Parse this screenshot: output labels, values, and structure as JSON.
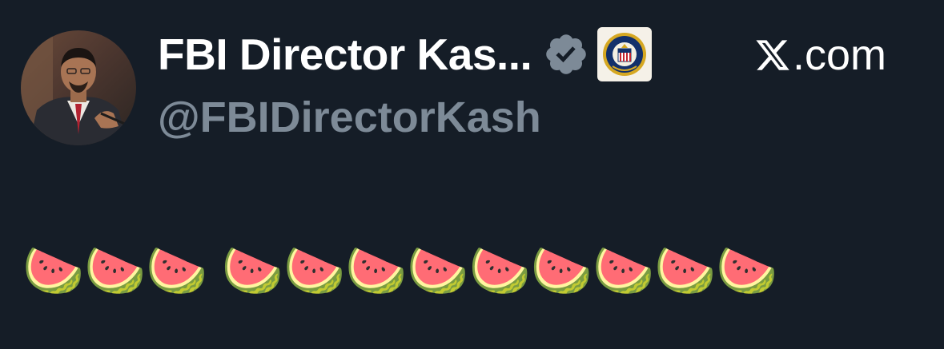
{
  "user": {
    "display_name": "FBI Director Kas...",
    "handle": "@FBIDirectorKash",
    "avatar_icon": "profile-photo",
    "verified_icon": "verified-badge-icon",
    "affiliate_icon": "fbi-seal-icon"
  },
  "brand": {
    "logo_icon": "x-logo-icon",
    "domain": ".com"
  },
  "tweet": {
    "text": "🍉🍉🍉 🍉🍉🍉🍉🍉🍉🍉🍉🍉"
  },
  "colors": {
    "background": "#151d27",
    "name": "#ffffff",
    "handle": "#7d8a97",
    "verified_badge": "#7d8a97"
  }
}
